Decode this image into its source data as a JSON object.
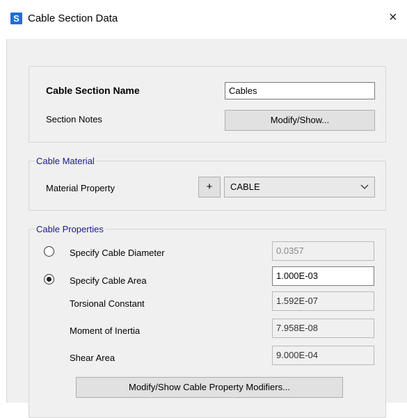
{
  "window": {
    "title": "Cable Section Data",
    "app_icon_letter": "S",
    "close_glyph": "×"
  },
  "section": {
    "name_label": "Cable Section Name",
    "name_value": "Cables",
    "notes_label": "Section Notes",
    "notes_button": "Modify/Show..."
  },
  "material": {
    "group_title": "Cable Material",
    "property_label": "Material Property",
    "add_button": "+",
    "selected": "CABLE"
  },
  "properties": {
    "group_title": "Cable Properties",
    "diameter_label": "Specify Cable Diameter",
    "diameter_value": "0.0357",
    "diameter_selected": false,
    "area_label": "Specify Cable Area",
    "area_value": "1.000E-03",
    "area_selected": true,
    "torsional_label": "Torsional Constant",
    "torsional_value": "1.592E-07",
    "inertia_label": "Moment of Inertia",
    "inertia_value": "7.958E-08",
    "shear_label": "Shear Area",
    "shear_value": "9.000E-04",
    "modifiers_button": "Modify/Show Cable Property Modifiers..."
  }
}
